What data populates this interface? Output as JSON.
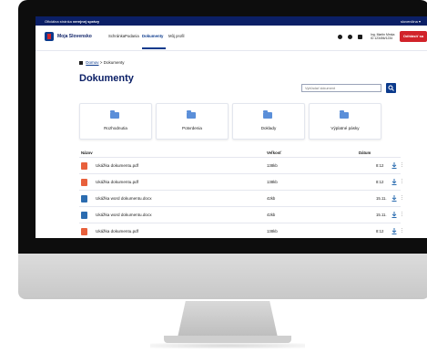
{
  "gov_bar": {
    "prefix": "Oficiálna stránka",
    "emphasis": "verejnej správy",
    "language": "slovenčina ▾"
  },
  "nav": {
    "brand": "Moja Slovensko",
    "items": [
      {
        "label": "Schránka"
      },
      {
        "label": "Podania"
      },
      {
        "label": "Dokumenty"
      },
      {
        "label": "Môj profil"
      }
    ],
    "user_name": "Ing. Martin Mrnka",
    "user_sub": "ID 123456/1234",
    "logout": "Odhlásiť sa"
  },
  "breadcrumb": {
    "home": "Domov",
    "separator": ">",
    "current": "Dokumenty"
  },
  "page": {
    "title": "Dokumenty",
    "search_placeholder": "Vyhľadať dokument"
  },
  "categories": [
    {
      "label": "Rozhodnutia"
    },
    {
      "label": "Potvrdenia"
    },
    {
      "label": "Doklady"
    },
    {
      "label": "Výplatné pásky"
    }
  ],
  "table": {
    "headers": {
      "name": "Názov",
      "size": "Veľkosť",
      "date": "Dátum"
    },
    "rows": [
      {
        "type": "pdf",
        "name": "Ukážka dokumentu.pdf",
        "size": "138kb",
        "date": "8:12"
      },
      {
        "type": "pdf",
        "name": "Ukážka dokumentu.pdf",
        "size": "138kb",
        "date": "8:12"
      },
      {
        "type": "doc",
        "name": "Ukážka word dokumentu.docx",
        "size": "42kb",
        "date": "15.11."
      },
      {
        "type": "doc",
        "name": "Ukážka word dokumentu.docx",
        "size": "42kb",
        "date": "15.11."
      },
      {
        "type": "pdf",
        "name": "Ukážka dokumentu.pdf",
        "size": "138kb",
        "date": "8:12"
      }
    ]
  },
  "colors": {
    "primary": "#0b3a8c",
    "danger": "#d1232a",
    "gov_bar": "#0b1f66"
  }
}
